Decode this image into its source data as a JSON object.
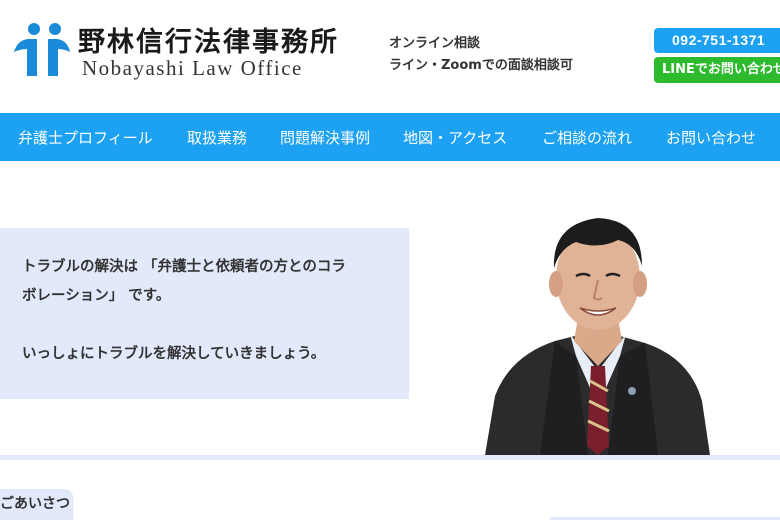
{
  "header": {
    "logo_jp": "野林信行法律事務所",
    "logo_en": "Nobayashi Law Office",
    "consult_line1": "オンライン相談",
    "consult_line2": "ライン・Zoomでの面談相談可",
    "phone": "092-751-1371",
    "line_button": "LINEでお問い合わせ"
  },
  "nav": {
    "items": [
      {
        "label": "弁護士プロフィール"
      },
      {
        "label": "取扱業務"
      },
      {
        "label": "問題解決事例"
      },
      {
        "label": "地図・アクセス"
      },
      {
        "label": "ご相談の流れ"
      },
      {
        "label": "お問い合わせ"
      }
    ]
  },
  "hero": {
    "line1": "トラブルの解決は 「弁護士と依頼者の方とのコラ",
    "line2": "ボレーション」 です。",
    "line3": "いっしょにトラブルを解決していきましょう。"
  },
  "greeting": {
    "tab": "ごあいさつ"
  },
  "colors": {
    "accent_blue": "#1da1f2",
    "line_green": "#2dbb2d",
    "pale_blue": "#e1e9fb",
    "logo_blue": "#1b8ad8"
  },
  "icons": {
    "logo": "two-figures-logo-icon"
  }
}
